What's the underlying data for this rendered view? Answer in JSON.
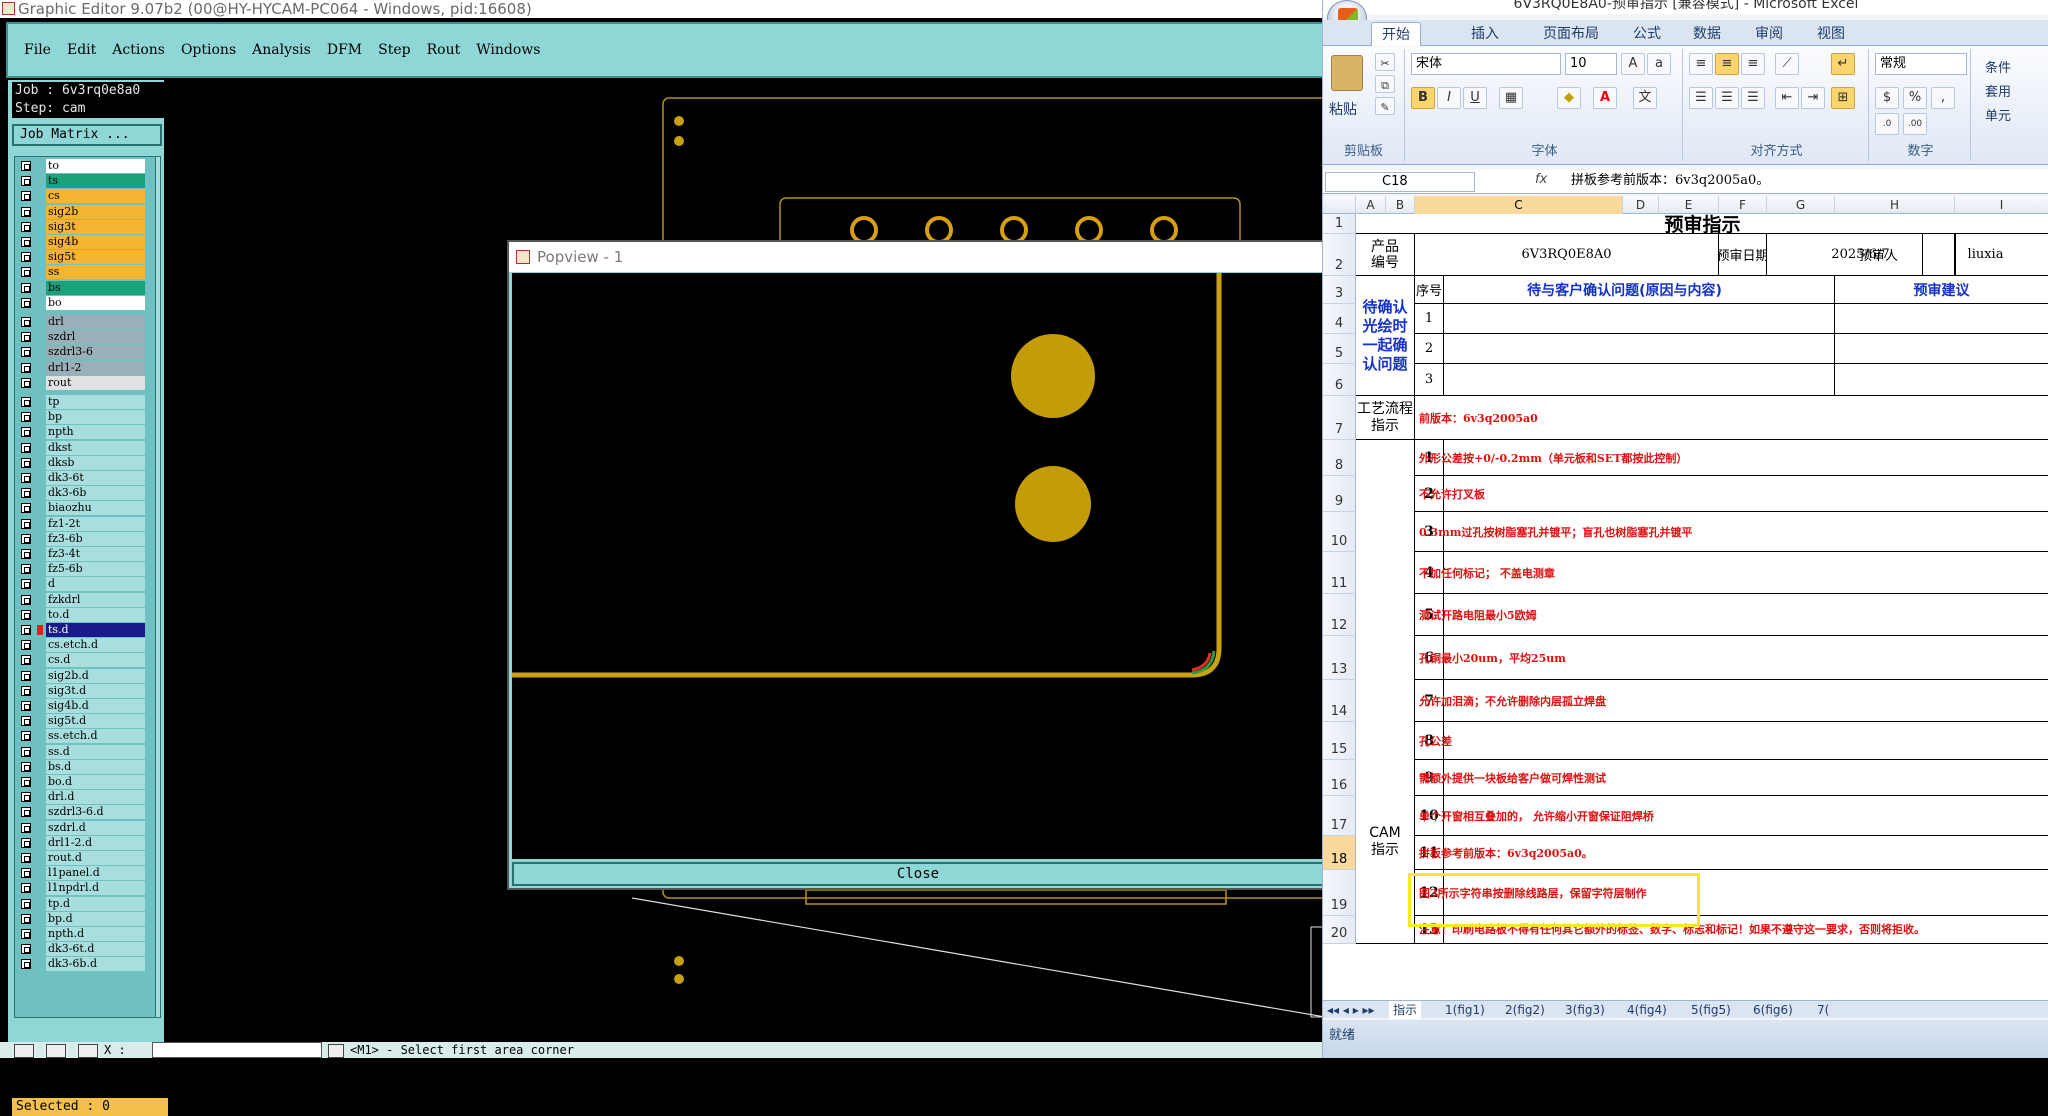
{
  "ge": {
    "title": "Graphic Editor 9.07b2 (00@HY-HYCAM-PC064 - Windows, pid:16608)",
    "menu": [
      "File",
      "Edit",
      "Actions",
      "Options",
      "Analysis",
      "DFM",
      "Step",
      "Rout",
      "Windows"
    ],
    "job": "Job : 6v3rq0e8a0",
    "step": "Step: cam",
    "job_matrix": "Job Matrix ...",
    "layers": [
      {
        "name": "to",
        "color": "#ffffff"
      },
      {
        "name": "ts",
        "color": "#1aa37a"
      },
      {
        "name": "cs",
        "color": "#f5b431"
      },
      {
        "name": "sig2b",
        "color": "#f5b431"
      },
      {
        "name": "sig3t",
        "color": "#f5b431"
      },
      {
        "name": "sig4b",
        "color": "#f5b431"
      },
      {
        "name": "sig5t",
        "color": "#f5b431"
      },
      {
        "name": "ss",
        "color": "#f5b431"
      },
      {
        "name": "bs",
        "color": "#1aa37a"
      },
      {
        "name": "bo",
        "color": "#ffffff"
      },
      {
        "name": "drl",
        "color": "#9ab0b8"
      },
      {
        "name": "szdrl",
        "color": "#9ab0b8"
      },
      {
        "name": "szdrl3-6",
        "color": "#9ab0b8"
      },
      {
        "name": "drl1-2",
        "color": "#9ab0b8"
      },
      {
        "name": "rout",
        "color": "#e1e1e1"
      },
      {
        "name": "tp",
        "color": "#a8dede"
      },
      {
        "name": "bp",
        "color": "#a8dede"
      },
      {
        "name": "npth",
        "color": "#a8dede"
      },
      {
        "name": "dkst",
        "color": "#a8dede"
      },
      {
        "name": "dksb",
        "color": "#a8dede"
      },
      {
        "name": "dk3-6t",
        "color": "#a8dede"
      },
      {
        "name": "dk3-6b",
        "color": "#a8dede"
      },
      {
        "name": "biaozhu",
        "color": "#a8dede"
      },
      {
        "name": "fz1-2t",
        "color": "#a8dede"
      },
      {
        "name": "fz3-6b",
        "color": "#a8dede"
      },
      {
        "name": "fz3-4t",
        "color": "#a8dede"
      },
      {
        "name": "fz5-6b",
        "color": "#a8dede"
      },
      {
        "name": "d",
        "color": "#a8dede"
      },
      {
        "name": "fzkdrl",
        "color": "#a8dede"
      },
      {
        "name": "to.d",
        "color": "#a8dede"
      },
      {
        "name": "ts.d",
        "color": "#a8dede"
      },
      {
        "name": "cs.etch.d",
        "color": "#a8dede"
      },
      {
        "name": "cs.d",
        "color": "#a8dede"
      },
      {
        "name": "sig2b.d",
        "color": "#a8dede"
      },
      {
        "name": "sig3t.d",
        "color": "#a8dede"
      },
      {
        "name": "sig4b.d",
        "color": "#a8dede"
      },
      {
        "name": "sig5t.d",
        "color": "#a8dede"
      },
      {
        "name": "ss.etch.d",
        "color": "#a8dede"
      },
      {
        "name": "ss.d",
        "color": "#a8dede"
      },
      {
        "name": "bs.d",
        "color": "#a8dede"
      },
      {
        "name": "bo.d",
        "color": "#a8dede"
      },
      {
        "name": "drl.d",
        "color": "#a8dede"
      },
      {
        "name": "szdrl3-6.d",
        "color": "#a8dede"
      },
      {
        "name": "szdrl.d",
        "color": "#a8dede"
      },
      {
        "name": "drl1-2.d",
        "color": "#a8dede"
      },
      {
        "name": "rout.d",
        "color": "#a8dede"
      },
      {
        "name": "l1panel.d",
        "color": "#a8dede"
      },
      {
        "name": "l1npdrl.d",
        "color": "#a8dede"
      },
      {
        "name": "tp.d",
        "color": "#a8dede"
      },
      {
        "name": "bp.d",
        "color": "#a8dede"
      },
      {
        "name": "npth.d",
        "color": "#a8dede"
      },
      {
        "name": "dk3-6t.d",
        "color": "#a8dede"
      },
      {
        "name": "dk3-6b.d",
        "color": "#a8dede"
      }
    ],
    "selected": "Selected : 0",
    "status_xy": "X : ",
    "status_msg": "<M1> - Select first area corner",
    "popview": {
      "title": "Popview - 1",
      "close": "Close"
    }
  },
  "xl": {
    "title": "6V3RQ0E8A0-预审指示 [兼容模式] - Microsoft Excel",
    "tabs": [
      "开始",
      "插入",
      "页面布局",
      "公式",
      "数据",
      "审阅",
      "视图"
    ],
    "clipboard": {
      "paste": "粘贴",
      "label": "剪贴板"
    },
    "font": {
      "name": "宋体",
      "size": "10",
      "label": "字体"
    },
    "align_label": "对齐方式",
    "number": {
      "format": "常规",
      "label": "数字"
    },
    "styles": [
      "条件",
      "套用",
      "单元"
    ],
    "namebox": "C18",
    "fx": "fx",
    "formula": "拼板参考前版本：6v3q2005a0。",
    "cols": [
      "A",
      "B",
      "C",
      "D",
      "E",
      "F",
      "G",
      "H",
      "I"
    ],
    "rows": [
      "1",
      "2",
      "3",
      "4",
      "5",
      "6",
      "7",
      "8",
      "9",
      "10",
      "11",
      "12",
      "13",
      "14",
      "15",
      "16",
      "17",
      "18",
      "19",
      "20"
    ],
    "sheet": {
      "title": "预审指示",
      "product_label": "产品编号",
      "product_code": "6V3RQ0E8A0",
      "review_date_label": "预审日期",
      "review_date": "2025/6/7",
      "reviewer_label": "预审人",
      "reviewer": "liuxia",
      "seq_label": "序号",
      "issues_label": "待与客户确认问题(原因与内容)",
      "suggest_label": "预审建议",
      "confirm_label": "待确认光绘时一起确认问题",
      "confirm_nums": [
        "1",
        "2",
        "3"
      ],
      "process_label": "工艺流程指示",
      "process_text": "前版本：6v3q2005a0",
      "cam_label": "CAM指示",
      "cam_items": [
        {
          "n": "1",
          "t": "外形公差按+0/-0.2mm（单元板和SET都按此控制）"
        },
        {
          "n": "2",
          "t": "不允许打叉板"
        },
        {
          "n": "3",
          "t": "0.3mm过孔按树脂塞孔并镀平；盲孔也树脂塞孔并镀平"
        },
        {
          "n": "4",
          "t": "不加任何标记；  不盖电测章"
        },
        {
          "n": "5",
          "t": "测试开路电阻最小5欧姆"
        },
        {
          "n": "6",
          "t": "孔铜最小20um，平均25um"
        },
        {
          "n": "7",
          "t": "允许加泪滴；不允许删除内层孤立焊盘"
        },
        {
          "n": "8",
          "t": "孔公差"
        },
        {
          "n": "9",
          "t": "需额外提供一块板给客户做可焊性测试"
        },
        {
          "n": "10",
          "t": "单个开窗相互叠加的， 允许缩小开窗保证阻焊桥"
        },
        {
          "n": "11",
          "t": "拼板参考前版本：6v3q2005a0。"
        },
        {
          "n": "12",
          "t": "图3所示字符串按删除线路层，保留字符层制作"
        },
        {
          "n": "13",
          "t": "注意！印刷电路板不得有任何其它额外的标签、数字、标志和标记！如果不遵守这一要求，否则将拒收。"
        }
      ]
    },
    "sheet_tabs": [
      "指示",
      "1(fig1)",
      "2(fig2)",
      "3(fig3)",
      "4(fig4)",
      "5(fig5)",
      "6(fig6)",
      "7("
    ],
    "status": "就绪"
  }
}
